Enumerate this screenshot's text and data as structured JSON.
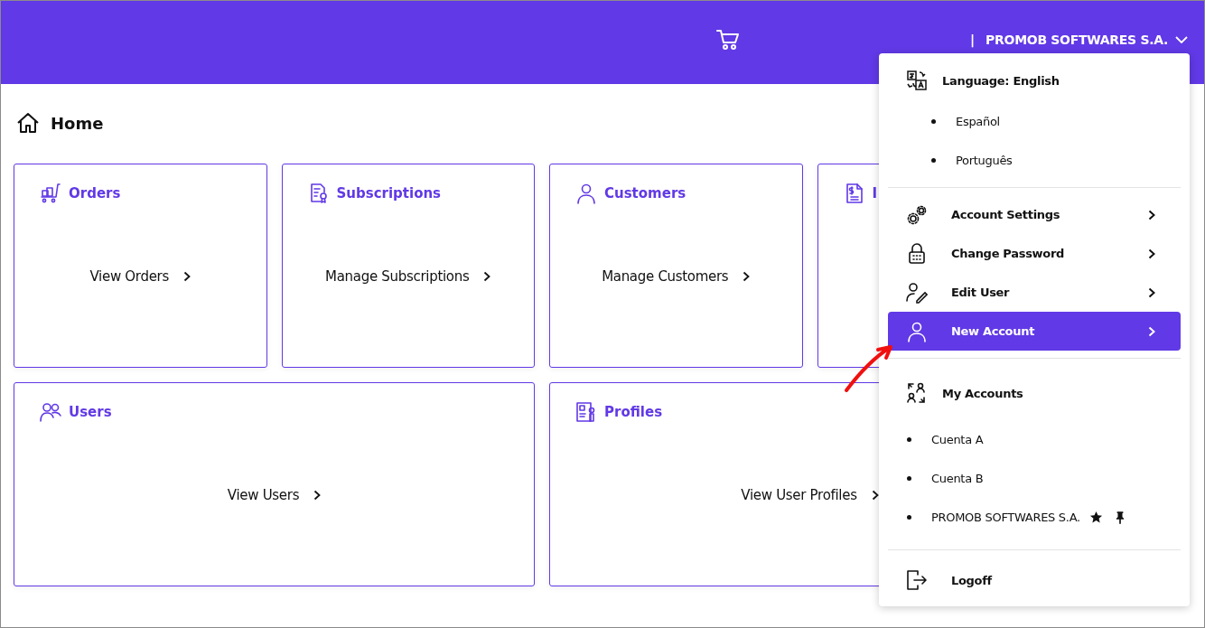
{
  "header": {
    "company": "PROMOB SOFTWARES S.A.",
    "separator": "|"
  },
  "breadcrumb": {
    "title": "Home"
  },
  "card_rows": [
    [
      {
        "title": "Orders",
        "link": "View Orders"
      },
      {
        "title": "Subscriptions",
        "link": "Manage Subscriptions"
      },
      {
        "title": "Customers",
        "link": "Manage Customers"
      },
      {
        "title": "I"
      }
    ],
    [
      {
        "title": "Users",
        "link": "View Users"
      },
      {
        "title": "Profiles",
        "link": "View User Profiles"
      }
    ]
  ],
  "dropdown": {
    "language": {
      "label": "Language: English",
      "options": [
        "Español",
        "Português"
      ]
    },
    "menu_items": [
      {
        "label": "Account Settings",
        "selected": false
      },
      {
        "label": "Change Password",
        "selected": false
      },
      {
        "label": "Edit User",
        "selected": false
      },
      {
        "label": "New Account",
        "selected": true
      }
    ],
    "my_accounts": {
      "label": "My Accounts",
      "accounts": [
        {
          "name": "Cuenta A",
          "starred": false,
          "pinned": false
        },
        {
          "name": "Cuenta B",
          "starred": false,
          "pinned": false
        },
        {
          "name": "PROMOB SOFTWARES S.A.",
          "starred": true,
          "pinned": true
        }
      ]
    },
    "logoff": "Logoff"
  }
}
